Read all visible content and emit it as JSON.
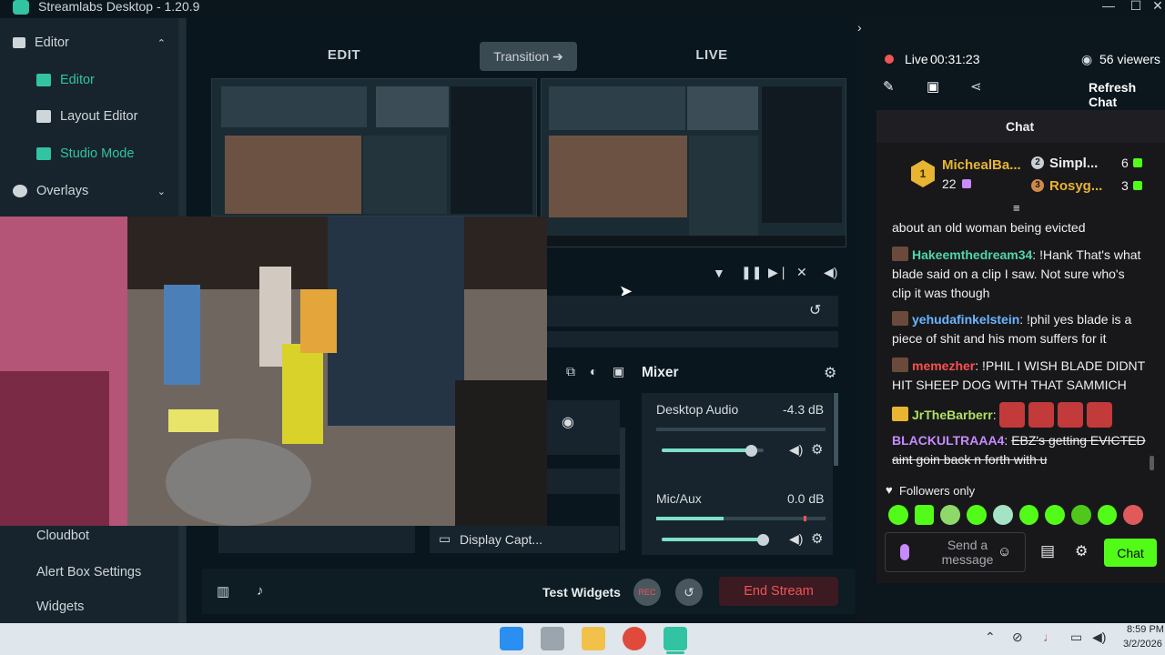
{
  "window": {
    "title": "Streamlabs Desktop - 1.20.9",
    "min": "—",
    "max": "☐",
    "close": "✕"
  },
  "sidebar": {
    "items": [
      {
        "label": "Editor",
        "expanded": true
      },
      {
        "label": "Editor"
      },
      {
        "label": "Layout Editor"
      },
      {
        "label": "Studio Mode"
      },
      {
        "label": "Overlays"
      },
      {
        "label": "Cloudbot"
      },
      {
        "label": "Alert Box Settings"
      },
      {
        "label": "Widgets"
      }
    ],
    "chevron_up": "⌃",
    "chevron_down": "⌄"
  },
  "studio": {
    "edit_label": "EDIT",
    "live_label": "LIVE",
    "transition_label": "Transition ➔"
  },
  "sources": {
    "display_capture": "Display Capt..."
  },
  "mixer": {
    "title": "Mixer",
    "channels": [
      {
        "name": "Desktop Audio",
        "db": "-4.3 dB",
        "volume": 0.8
      },
      {
        "name": "Mic/Aux",
        "db": "0.0 dB",
        "volume": 1.0
      }
    ]
  },
  "bottom": {
    "test_widgets": "Test Widgets",
    "rec": "REC",
    "end_stream": "End Stream"
  },
  "chat": {
    "live_text": "Live",
    "live_time": "00:31:23",
    "viewers": "56 viewers",
    "refresh": "Refresh Chat",
    "header": "Chat",
    "leaderboard": [
      {
        "rank": "1",
        "name": "MichealBa...",
        "count": "22"
      },
      {
        "rank": "2",
        "name": "Simpl...",
        "count": "6"
      },
      {
        "rank": "3",
        "name": "Rosyg...",
        "count": "3"
      }
    ],
    "messages": [
      {
        "user": "",
        "text": "about an old woman being evicted",
        "color": "#efeff1"
      },
      {
        "user": "Hakeemthedream34",
        "text": "!Hank That's what blade said on a clip I saw. Not sure who's clip it was though",
        "color": "#4fd6a6"
      },
      {
        "user": "yehudafinkelstein",
        "text": "!phil yes blade is a piece of shit and his mom suffers for it",
        "color": "#6bb6ff"
      },
      {
        "user": "memezher",
        "text": "!PHIL I WISH BLADE DIDNT HIT SHEEP DOG WITH THAT SAMMICH",
        "color": "#ff4f4f"
      },
      {
        "user": "JrTheBarberr",
        "text": "",
        "color": "#b0e060"
      },
      {
        "user": "BLACKULTRAAA4",
        "text": "EBZ's getting EVICTED aint goin back n forth with u",
        "color": "#c88aff"
      }
    ],
    "followers_only": "Followers only",
    "send_placeholder": "Send a message",
    "chat_button": "Chat"
  },
  "taskbar": {
    "time": "8:59 PM",
    "date": "3/2/2026"
  },
  "colors": {
    "accent": "#31c3a2",
    "danger": "#f05555",
    "chat_green": "#53fc18"
  }
}
